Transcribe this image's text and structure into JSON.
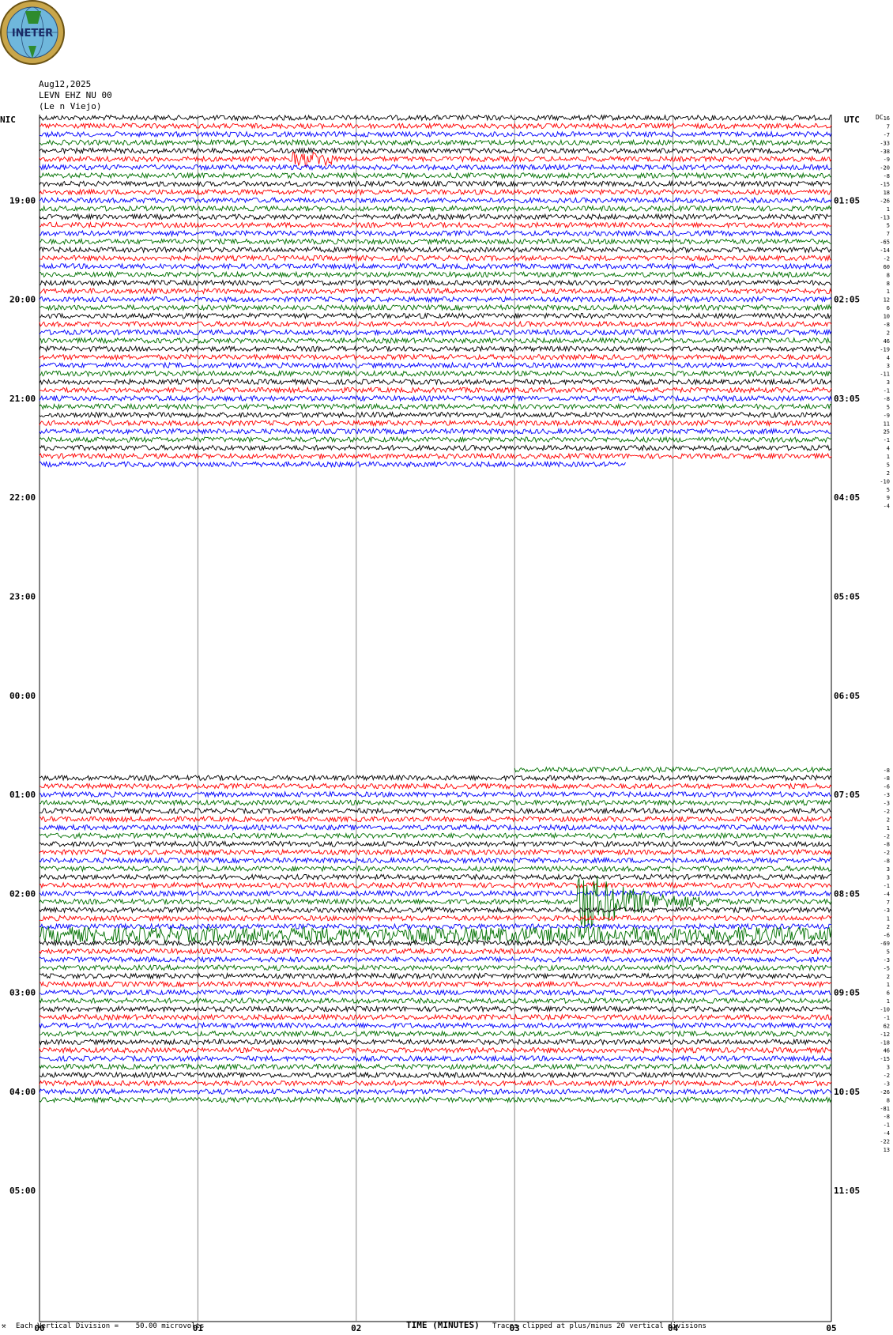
{
  "logo": {
    "text": "INETER"
  },
  "header": {
    "date": "Aug12,2025",
    "station": "LEVN EHZ NU 00",
    "location": "(Le n Viejo)"
  },
  "labels": {
    "left_tz": "NIC",
    "right_tz": "UTC",
    "dc": "DC",
    "xlabel": "TIME (MINUTES)",
    "footer_left": "Each Vertical Division =    50.00 microvolts",
    "footer_right": "Traces clipped at plus/minus 20 vertical divisions"
  },
  "colors": {
    "cycle": [
      "#000000",
      "#ff0000",
      "#0000ff",
      "#007000"
    ],
    "grid": "#888888"
  },
  "chart_data": {
    "type": "line",
    "x_ticks": [
      "00",
      "01",
      "02",
      "03",
      "04",
      "05"
    ],
    "xlim": [
      0,
      5
    ],
    "minutes_per_line": 5,
    "lines_per_hour": 12,
    "rows": 120,
    "left_hour_labels": [
      "19:00",
      "20:00",
      "21:00",
      "22:00",
      "23:00",
      "00:00",
      "01:00",
      "02:00",
      "03:00",
      "04:00",
      "05:00"
    ],
    "right_hour_labels": [
      "01:05",
      "02:05",
      "03:05",
      "04:05",
      "05:05",
      "06:05",
      "07:05",
      "08:05",
      "09:05",
      "10:05",
      "11:05"
    ],
    "first_hour_label_row": 10,
    "data_blocks": [
      {
        "start_row": 0,
        "end_row": 42,
        "last_row_end_minute": 3.7
      },
      {
        "start_row": 79,
        "end_row": 119,
        "first_row_start_minute": 3.0
      }
    ],
    "dc_offsets_top": [
      "16",
      "7",
      "-7",
      "-33",
      "-38",
      "-9",
      "-20",
      "-8",
      "-15",
      "18",
      "-26",
      "1",
      "-13",
      "5",
      "7",
      "-65",
      "-14",
      "-2",
      "60",
      "8",
      "8",
      "1",
      "12",
      "6",
      "10",
      "-8",
      "2",
      "46",
      "-19",
      "4",
      "3",
      "-11",
      "3",
      "-1",
      "-8",
      "5",
      "-9",
      "11",
      "25",
      "-1",
      "4",
      "1",
      "5",
      "2",
      "-10",
      "5",
      "9",
      "-4"
    ],
    "dc_offsets_bottom": [
      "-8",
      "-8",
      "-6",
      "-3",
      "-3",
      "-2",
      "2",
      "1",
      "-2",
      "-8",
      "-2",
      "-8",
      "3",
      "3",
      "-1",
      "-4",
      "7",
      "-3",
      "1",
      "2",
      "-6",
      "-69",
      "5",
      "-3",
      "-5",
      "2",
      "1",
      "6",
      "1",
      "-10",
      "-1",
      "62",
      "-12",
      "-18",
      "46",
      "-15",
      "3",
      "-2",
      "-3",
      "-26",
      "8",
      "-81",
      "-8",
      "-1",
      "-4",
      "-22",
      "13"
    ],
    "events": [
      {
        "row": 5,
        "start_minute": 1.6,
        "end_minute": 1.85,
        "note": "noise burst"
      },
      {
        "row": 95,
        "start_minute": 3.4,
        "end_minute": 4.3,
        "note": "earthquake signal"
      },
      {
        "row": 99,
        "start_minute": 0.0,
        "end_minute": 5.0,
        "note": "noisy interval"
      }
    ]
  }
}
